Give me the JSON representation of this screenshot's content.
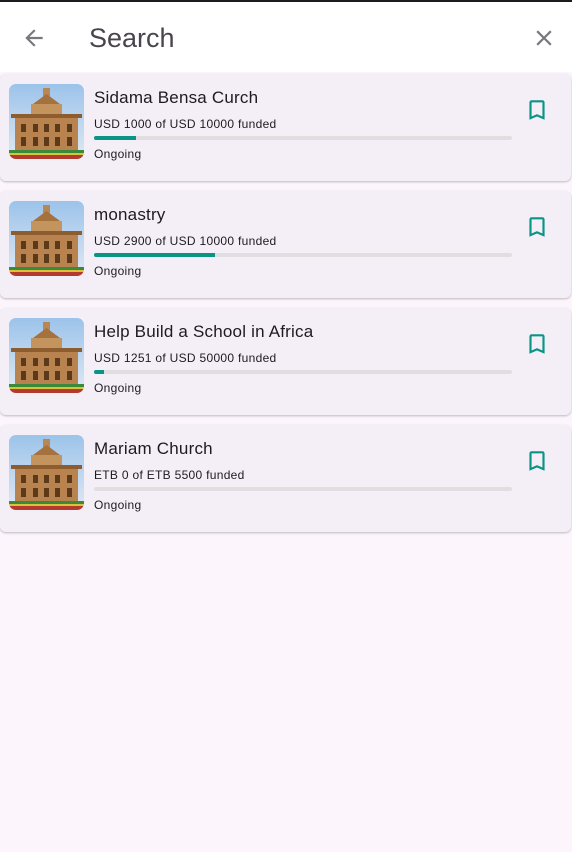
{
  "search": {
    "placeholder": "Search"
  },
  "icons": {
    "back": "arrow-back-icon",
    "close": "close-icon",
    "bookmark": "bookmark-outline-icon",
    "accent": "#0a9485"
  },
  "projects": [
    {
      "title": "Sidama Bensa Curch",
      "funded_text": "USD 1000 of USD 10000 funded",
      "progress": 0.1,
      "status": "Ongoing"
    },
    {
      "title": "monastry",
      "funded_text": "USD 2900 of USD 10000 funded",
      "progress": 0.29,
      "status": "Ongoing"
    },
    {
      "title": "Help Build a School in Africa",
      "funded_text": "USD 1251 of USD 50000 funded",
      "progress": 0.025,
      "status": "Ongoing"
    },
    {
      "title": "Mariam Church",
      "funded_text": "ETB 0 of ETB 5500 funded",
      "progress": 0,
      "status": "Ongoing"
    }
  ]
}
